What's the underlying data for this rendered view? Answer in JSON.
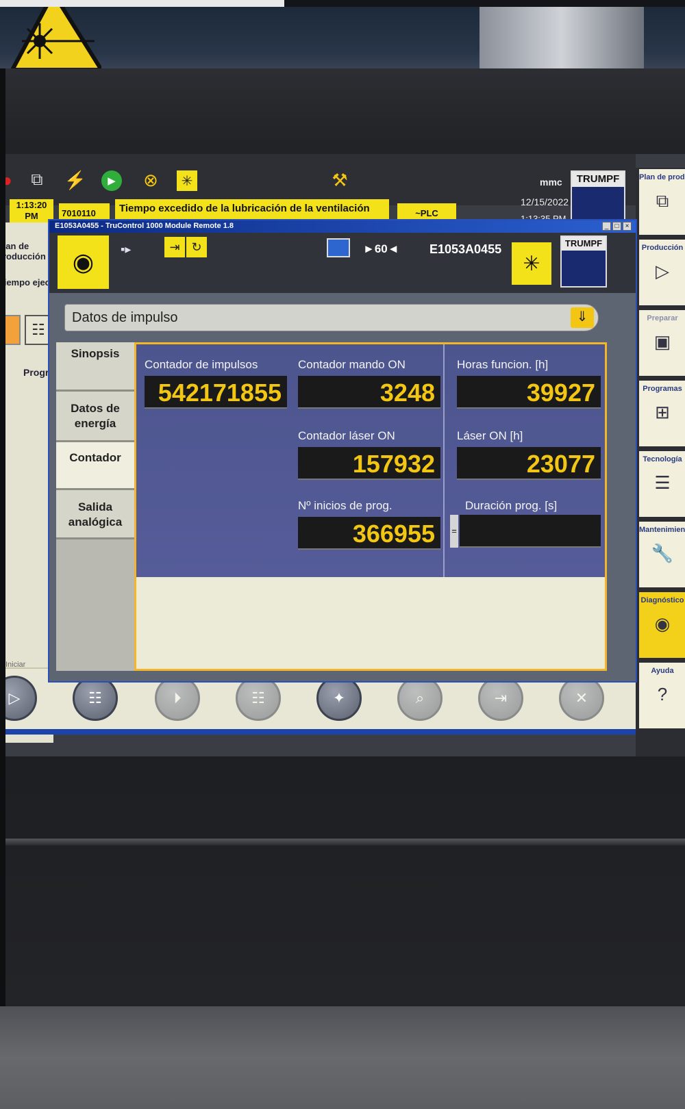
{
  "topbar": {
    "user": "mmc",
    "date": "12/15/2022",
    "time": "1:13:35 PM",
    "brand": "TRUMPF"
  },
  "message": {
    "time": "1:13:20 PM",
    "code": "7010110",
    "text": "Tiempo excedido de la lubricación de la ventilación",
    "source": "~PLC"
  },
  "left_app": {
    "plan_label": "Plan de producción",
    "tiempo_label": "Tiempo ejec.",
    "prog_label": "Progr",
    "iniciar_label": "Iniciar"
  },
  "right_sidebar": [
    {
      "label": "Plan de producción",
      "icon": "layers-icon",
      "glyph": "⧉"
    },
    {
      "label": "Producción",
      "icon": "play-frame-icon",
      "glyph": "▷"
    },
    {
      "label": "Preparar",
      "icon": "prepare-icon",
      "glyph": "▣"
    },
    {
      "label": "Programas",
      "icon": "programs-icon",
      "glyph": "⊞"
    },
    {
      "label": "Tecnología",
      "icon": "technology-icon",
      "glyph": "☰"
    },
    {
      "label": "Mantenimiento",
      "icon": "wrench-icon",
      "glyph": "🔧"
    },
    {
      "label": "Diagnóstico",
      "icon": "eye-icon",
      "glyph": "◉"
    },
    {
      "label": "Ayuda",
      "icon": "help-icon",
      "glyph": "?"
    }
  ],
  "dialog": {
    "title": "E1053A0455 - TruControl 1000 Module Remote 1.8",
    "speed": "►60◄",
    "machine_id": "E1053A0455",
    "brand": "TRUMPF",
    "dropdown_value": "Datos de impulso",
    "tabs": [
      {
        "label": "Sinopsis"
      },
      {
        "label": "Datos de energía"
      },
      {
        "label": "Contador"
      },
      {
        "label": "Salida analógica"
      }
    ],
    "counters": {
      "contador_impulsos": {
        "label": "Contador de impulsos",
        "value": "542171855"
      },
      "contador_mando": {
        "label": "Contador mando ON",
        "value": "3248"
      },
      "horas_funcion": {
        "label": "Horas funcion. [h]",
        "value": "39927"
      },
      "contador_laser": {
        "label": "Contador láser ON",
        "value": "157932"
      },
      "laser_on": {
        "label": "Láser ON [h]",
        "value": "23077"
      },
      "inicios_prog": {
        "label": "Nº inicios de prog.",
        "value": "366955"
      },
      "duracion_prog": {
        "label": "Duración prog. [s]",
        "value": ""
      }
    },
    "duration_marker": "="
  },
  "colors": {
    "accent_yellow": "#f3e21a",
    "counter_text": "#f3c613",
    "panel_blue": "#4d558e",
    "title_blue": "#0c2a84"
  }
}
